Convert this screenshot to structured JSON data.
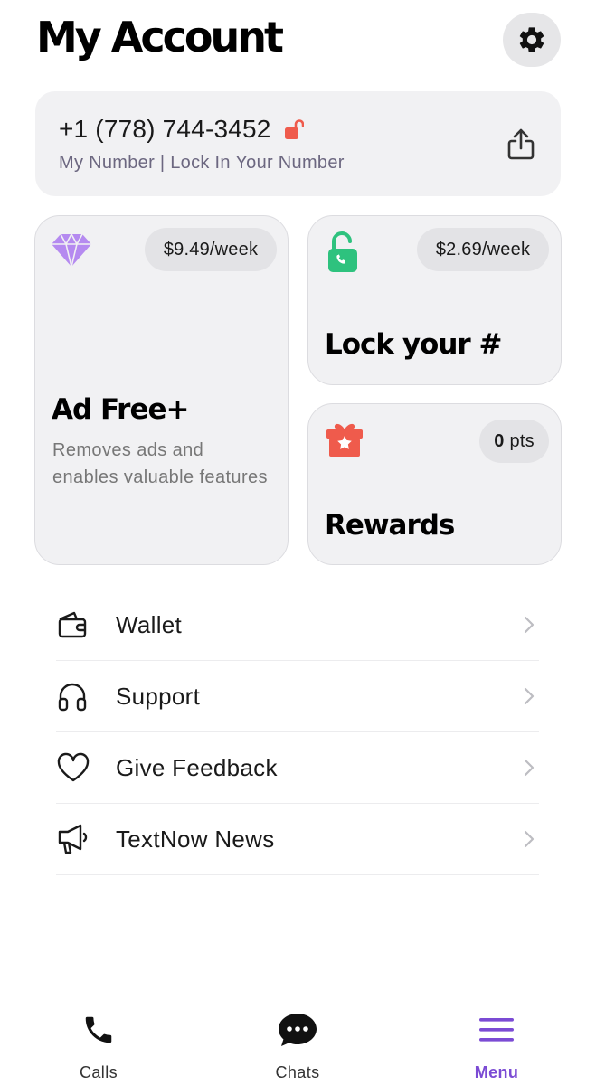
{
  "header": {
    "title": "My Account",
    "settings_icon": "gear-icon"
  },
  "number_card": {
    "phone_number": "+1 (778) 744-3452",
    "subtitle": "My Number | Lock In Your Number",
    "lock_icon": "unlocked-padlock-icon",
    "share_icon": "share-icon"
  },
  "tiles": {
    "ad_free": {
      "price": "$9.49/week",
      "title": "Ad Free+",
      "description": "Removes ads and enables valuable features",
      "icon": "diamond-icon",
      "icon_color": "#b58af0"
    },
    "lock_number": {
      "price": "$2.69/week",
      "title": "Lock your #",
      "icon": "phone-lock-icon",
      "icon_color": "#2ec27e"
    },
    "rewards": {
      "points_value": "0",
      "points_unit": "pts",
      "title": "Rewards",
      "icon": "gift-icon",
      "icon_color": "#ef5b4c"
    }
  },
  "menu": {
    "items": [
      {
        "label": "Wallet",
        "icon": "wallet-icon"
      },
      {
        "label": "Support",
        "icon": "headphones-icon"
      },
      {
        "label": "Give Feedback",
        "icon": "heart-icon"
      },
      {
        "label": "TextNow News",
        "icon": "megaphone-icon"
      }
    ]
  },
  "bottom_nav": {
    "items": [
      {
        "label": "Calls",
        "icon": "phone-icon",
        "active": false
      },
      {
        "label": "Chats",
        "icon": "chat-bubble-icon",
        "active": false
      },
      {
        "label": "Menu",
        "icon": "hamburger-menu-icon",
        "active": true
      }
    ],
    "active_color": "#7b4bd4"
  }
}
